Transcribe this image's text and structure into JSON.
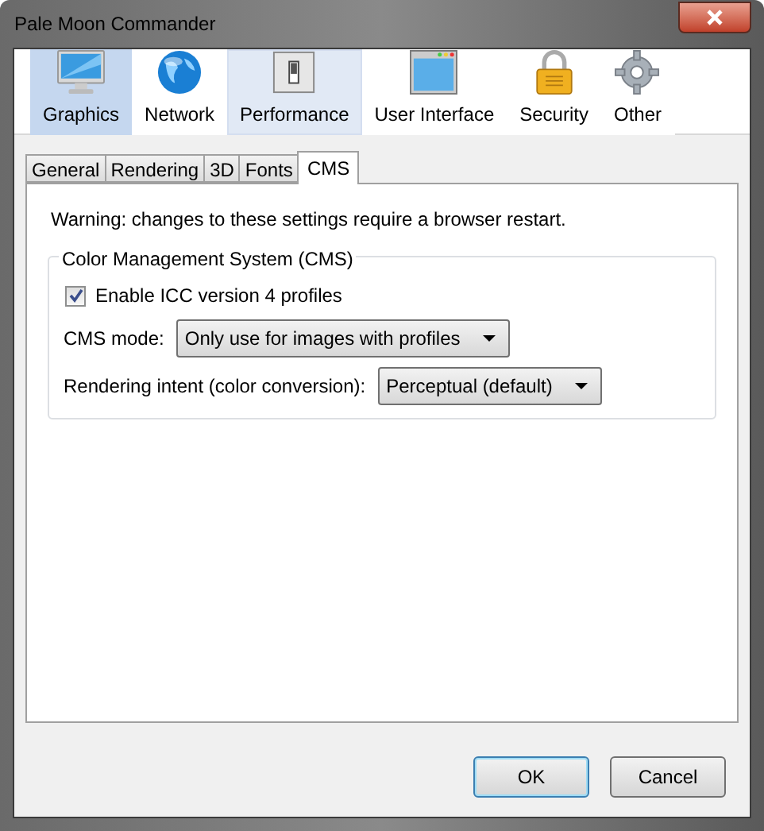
{
  "window": {
    "title": "Pale Moon Commander"
  },
  "panes": [
    {
      "label": "Graphics",
      "kind": "monitor",
      "selected": true,
      "hovered": false
    },
    {
      "label": "Network",
      "kind": "globe",
      "selected": false,
      "hovered": false
    },
    {
      "label": "Performance",
      "kind": "switch",
      "selected": false,
      "hovered": true
    },
    {
      "label": "User Interface",
      "kind": "window",
      "selected": false,
      "hovered": false
    },
    {
      "label": "Security",
      "kind": "lock",
      "selected": false,
      "hovered": false
    },
    {
      "label": "Other",
      "kind": "gear",
      "selected": false,
      "hovered": false
    }
  ],
  "tabs": [
    {
      "label": "General",
      "selected": false
    },
    {
      "label": "Rendering",
      "selected": false
    },
    {
      "label": "3D",
      "selected": false
    },
    {
      "label": "Fonts",
      "selected": false
    },
    {
      "label": "CMS",
      "selected": true
    }
  ],
  "warning": "Warning: changes to these settings require a browser restart.",
  "group": {
    "title": "Color Management System (CMS)",
    "checkbox": {
      "label": "Enable ICC version 4 profiles",
      "checked": true
    },
    "fields": [
      {
        "label": "CMS mode:",
        "value": "Only use for images with profiles"
      },
      {
        "label": "Rendering intent (color conversion):",
        "value": "Perceptual (default)"
      }
    ]
  },
  "buttons": [
    {
      "label": "OK",
      "default": true
    },
    {
      "label": "Cancel",
      "default": false
    }
  ]
}
